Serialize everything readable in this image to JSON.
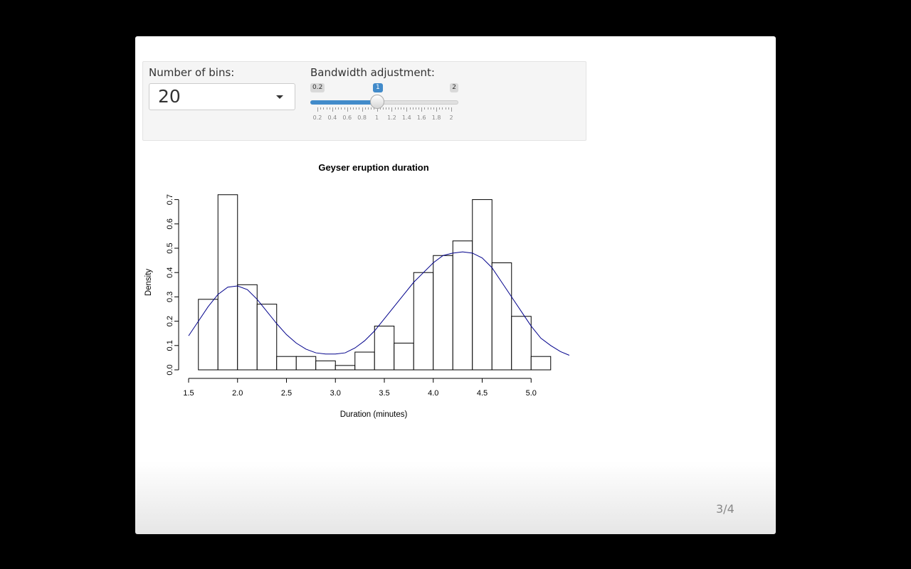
{
  "controls": {
    "bins_label": "Number of bins:",
    "bins_value": "20",
    "bw_label": "Bandwidth adjustment:",
    "bw_min": "0.2",
    "bw_max": "2",
    "bw_value": "1",
    "bw_value_num": 1,
    "bw_ticks": [
      "0.2",
      "0.4",
      "0.6",
      "0.8",
      "1",
      "1.2",
      "1.4",
      "1.6",
      "1.8",
      "2"
    ]
  },
  "colors": {
    "accent": "#428bca",
    "density_line": "#00008b"
  },
  "icons": {
    "select_caret": "chevron-down-icon"
  },
  "chart_data": {
    "type": "bar",
    "title": "Geyser eruption duration",
    "xlabel": "Duration (minutes)",
    "ylabel": "Density",
    "xlim": [
      1.5,
      5.4
    ],
    "ylim": [
      0,
      0.72
    ],
    "xticks": [
      "1.5",
      "2.0",
      "2.5",
      "3.0",
      "3.5",
      "4.0",
      "4.5",
      "5.0"
    ],
    "yticks": [
      "0.0",
      "0.1",
      "0.2",
      "0.3",
      "0.4",
      "0.5",
      "0.6",
      "0.7"
    ],
    "bin_edges": [
      1.6,
      1.8,
      2.0,
      2.2,
      2.4,
      2.6,
      2.8,
      3.0,
      3.2,
      3.4,
      3.6,
      3.8,
      4.0,
      4.2,
      4.4,
      4.6,
      4.8,
      5.0,
      5.2
    ],
    "values": [
      0.29,
      0.72,
      0.35,
      0.27,
      0.055,
      0.055,
      0.037,
      0.018,
      0.073,
      0.18,
      0.11,
      0.4,
      0.47,
      0.53,
      0.7,
      0.44,
      0.22,
      0.055
    ],
    "series": [
      {
        "x": [
          1.5,
          1.6,
          1.7,
          1.8,
          1.9,
          2.0,
          2.1,
          2.2,
          2.3,
          2.4,
          2.5,
          2.6,
          2.7,
          2.8,
          2.9,
          3.0,
          3.1,
          3.2,
          3.3,
          3.4,
          3.5,
          3.6,
          3.7,
          3.8,
          3.9,
          4.0,
          4.1,
          4.2,
          4.3,
          4.4,
          4.5,
          4.6,
          4.7,
          4.8,
          4.9,
          5.0,
          5.1,
          5.2,
          5.3,
          5.39
        ],
        "y": [
          0.14,
          0.2,
          0.26,
          0.31,
          0.34,
          0.345,
          0.33,
          0.29,
          0.24,
          0.19,
          0.145,
          0.11,
          0.085,
          0.07,
          0.065,
          0.065,
          0.07,
          0.09,
          0.12,
          0.16,
          0.21,
          0.26,
          0.31,
          0.36,
          0.4,
          0.44,
          0.47,
          0.48,
          0.485,
          0.48,
          0.46,
          0.42,
          0.36,
          0.3,
          0.24,
          0.18,
          0.13,
          0.1,
          0.075,
          0.06
        ]
      }
    ]
  },
  "footer": {
    "page": "3/4"
  }
}
